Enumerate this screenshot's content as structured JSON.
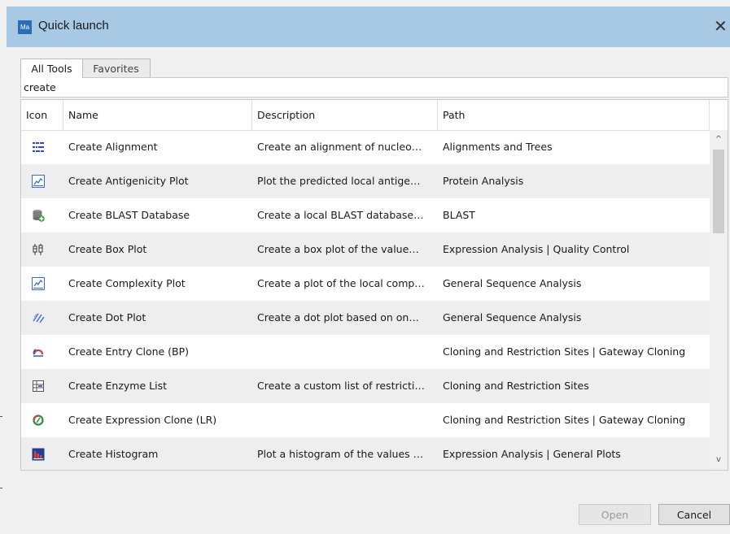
{
  "window": {
    "app_icon_label": "Ma",
    "title": "Quick launch",
    "close_glyph": "✕"
  },
  "tabs": [
    {
      "label": "All Tools"
    },
    {
      "label": "Favorites"
    }
  ],
  "search": {
    "value": "create"
  },
  "table": {
    "headers": {
      "icon": "Icon",
      "name": "Name",
      "description": "Description",
      "path": "Path"
    },
    "rows": [
      {
        "icon": "alignment-icon",
        "name": "Create Alignment",
        "description": "Create an alignment of nucleo…",
        "path": "Alignments and Trees"
      },
      {
        "icon": "line-plot-icon",
        "name": "Create Antigenicity Plot",
        "description": "Plot the predicted local antige…",
        "path": "Protein Analysis"
      },
      {
        "icon": "database-add-icon",
        "name": "Create BLAST Database",
        "description": "Create a local BLAST database…",
        "path": "BLAST"
      },
      {
        "icon": "box-plot-icon",
        "name": "Create Box Plot",
        "description": "Create a box plot of the value…",
        "path": "Expression Analysis | Quality Control"
      },
      {
        "icon": "line-plot-icon",
        "name": "Create Complexity Plot",
        "description": "Create a plot of the local comp…",
        "path": "General Sequence Analysis"
      },
      {
        "icon": "dot-plot-icon",
        "name": "Create Dot Plot",
        "description": "Create a dot plot based on on…",
        "path": "General Sequence Analysis"
      },
      {
        "icon": "entry-clone-icon",
        "name": "Create Entry Clone (BP)",
        "description": "",
        "path": "Cloning and Restriction Sites | Gateway Cloning"
      },
      {
        "icon": "enzyme-list-icon",
        "name": "Create Enzyme List",
        "description": "Create a custom list of restricti…",
        "path": "Cloning and Restriction Sites"
      },
      {
        "icon": "expression-clone-icon",
        "name": "Create Expression Clone (LR)",
        "description": "",
        "path": "Cloning and Restriction Sites | Gateway Cloning"
      },
      {
        "icon": "histogram-icon",
        "name": "Create Histogram",
        "description": "Plot a histogram of the values …",
        "path": "Expression Analysis | General Plots"
      }
    ]
  },
  "scrollbar": {
    "up_glyph": "^",
    "down_glyph": "v"
  },
  "buttons": {
    "open": "Open",
    "cancel": "Cancel"
  }
}
